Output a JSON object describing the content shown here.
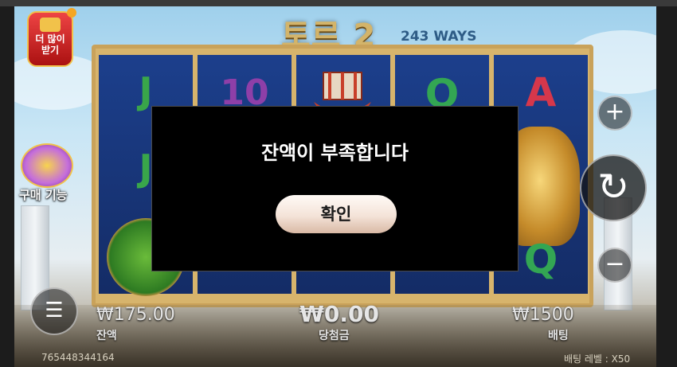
{
  "game": {
    "logo_title": "토르 2",
    "ways_text": "243 WAYS"
  },
  "left_controls": {
    "buy_more_label": "더 많이 받기",
    "buy_feature_label": "구매 기능"
  },
  "right_controls": {
    "plus_icon": "plus-icon",
    "spin_icon": "refresh-icon",
    "minus_icon": "minus-icon"
  },
  "reels": {
    "visible_symbols": [
      "J",
      "10",
      "Q",
      "A",
      "J",
      "Q"
    ]
  },
  "bottom": {
    "balance_value": "₩175.00",
    "balance_label": "잔액",
    "win_value": "₩0.00",
    "win_label": "당첨금",
    "bet_value": "₩1500",
    "bet_label": "배팅",
    "session_id": "765448344164",
    "bet_level_label": "배팅 레벨 : X50"
  },
  "modal": {
    "message": "잔액이 부족합니다",
    "confirm_label": "확인"
  },
  "colors": {
    "modal_bg": "#000000",
    "confirm_button": "#f4e3d8",
    "reel_bg": "#1c3f8c",
    "frame_gold": "#c9a25a"
  }
}
